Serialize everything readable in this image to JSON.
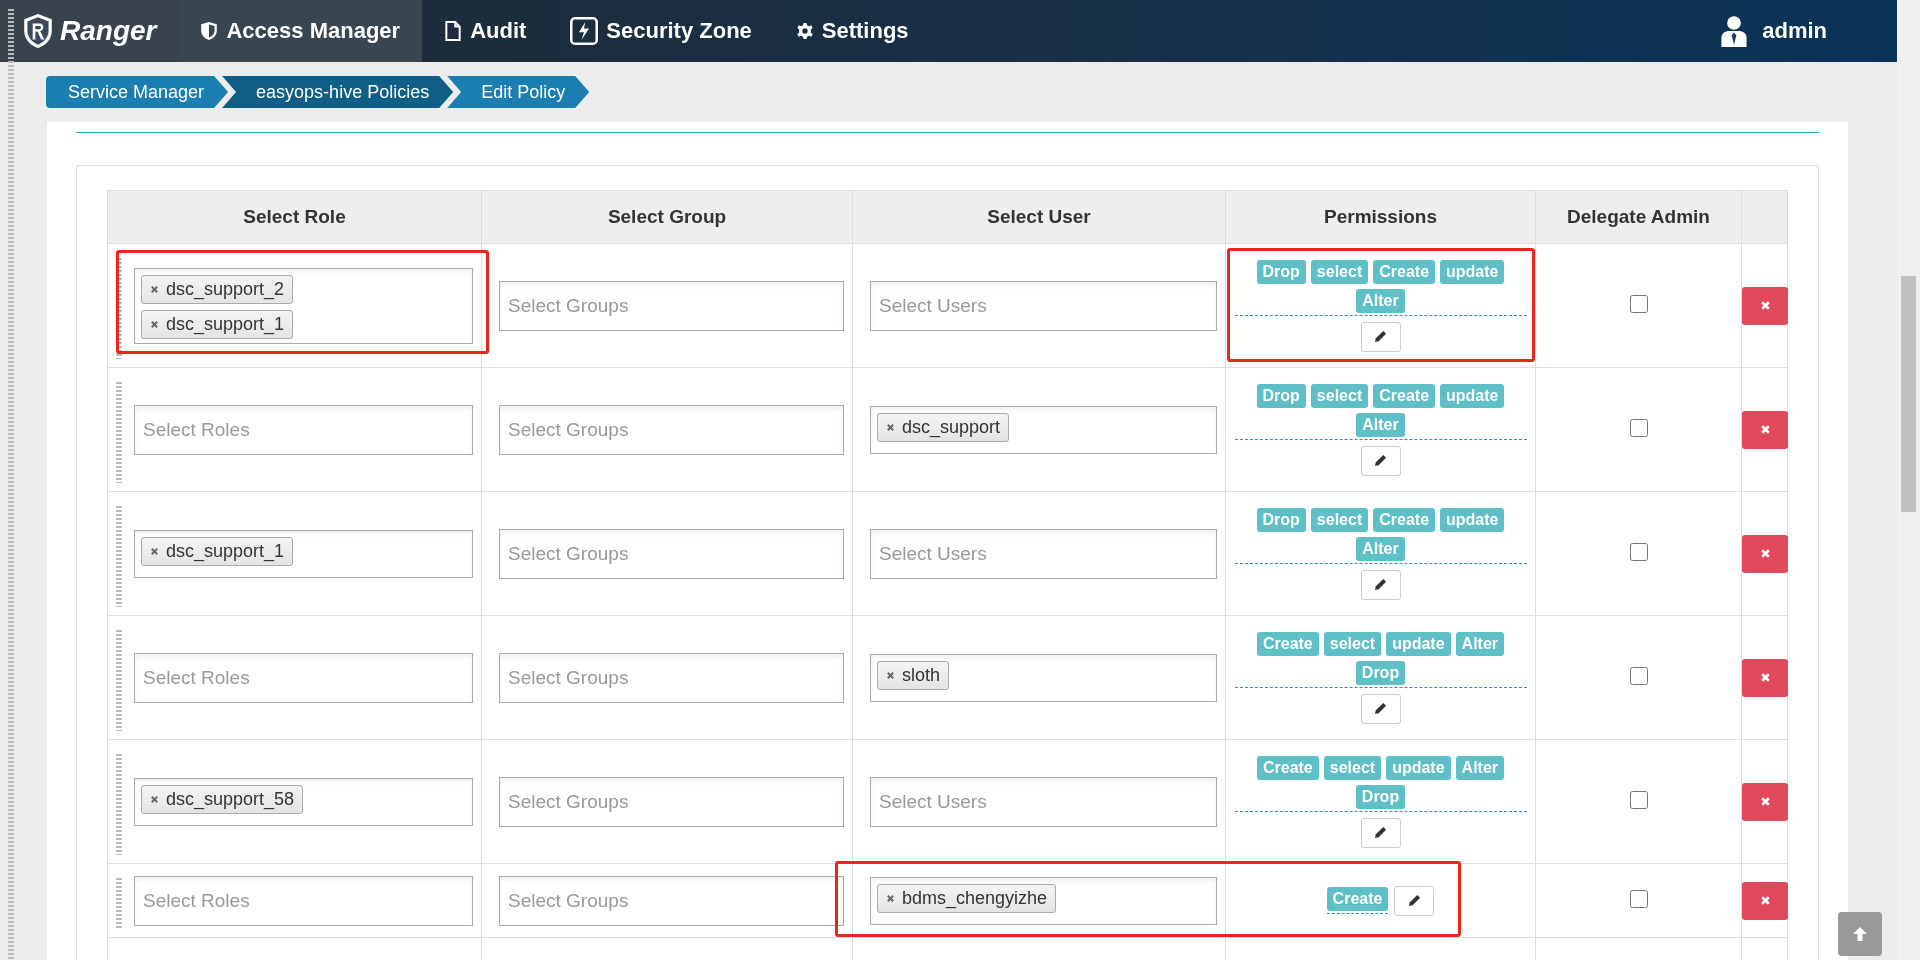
{
  "navbar": {
    "brand": "Ranger",
    "items": [
      {
        "label": "Access Manager",
        "selected": true
      },
      {
        "label": "Audit",
        "selected": false
      },
      {
        "label": "Security Zone",
        "selected": false
      },
      {
        "label": "Settings",
        "selected": false
      }
    ],
    "user": "admin"
  },
  "breadcrumb": [
    "Service Manager",
    "easyops-hive Policies",
    "Edit Policy"
  ],
  "table": {
    "columns": [
      "Select Role",
      "Select Group",
      "Select User",
      "Permissions",
      "Delegate Admin"
    ],
    "rows": [
      {
        "roles": {
          "tags": [
            "dsc_support_2",
            "dsc_support_1"
          ],
          "highlighted": true
        },
        "groups": {
          "placeholder": "Select Groups"
        },
        "users": {
          "placeholder": "Select Users"
        },
        "permissions": {
          "tags": [
            "Drop",
            "select",
            "Create",
            "update",
            "Alter"
          ],
          "highlighted": true
        },
        "delegate_admin": false
      },
      {
        "roles": {
          "placeholder": "Select Roles"
        },
        "groups": {
          "placeholder": "Select Groups"
        },
        "users": {
          "tags": [
            "dsc_support"
          ]
        },
        "permissions": {
          "tags": [
            "Drop",
            "select",
            "Create",
            "update",
            "Alter"
          ]
        },
        "delegate_admin": false
      },
      {
        "roles": {
          "tags": [
            "dsc_support_1"
          ]
        },
        "groups": {
          "placeholder": "Select Groups"
        },
        "users": {
          "placeholder": "Select Users"
        },
        "permissions": {
          "tags": [
            "Drop",
            "select",
            "Create",
            "update",
            "Alter"
          ]
        },
        "delegate_admin": false
      },
      {
        "roles": {
          "placeholder": "Select Roles"
        },
        "groups": {
          "placeholder": "Select Groups"
        },
        "users": {
          "tags": [
            "sloth"
          ]
        },
        "permissions": {
          "tags": [
            "Create",
            "select",
            "update",
            "Alter",
            "Drop"
          ]
        },
        "delegate_admin": false
      },
      {
        "roles": {
          "tags": [
            "dsc_support_58"
          ]
        },
        "groups": {
          "placeholder": "Select Groups"
        },
        "users": {
          "placeholder": "Select Users"
        },
        "permissions": {
          "tags": [
            "Create",
            "select",
            "update",
            "Alter",
            "Drop"
          ]
        },
        "delegate_admin": false
      },
      {
        "roles": {
          "placeholder": "Select Roles"
        },
        "groups": {
          "placeholder": "Select Groups"
        },
        "users": {
          "tags": [
            "bdms_chengyizhe"
          ],
          "highlighted": true
        },
        "permissions": {
          "tags": [
            "Create"
          ]
        },
        "delegate_admin": false
      }
    ]
  }
}
